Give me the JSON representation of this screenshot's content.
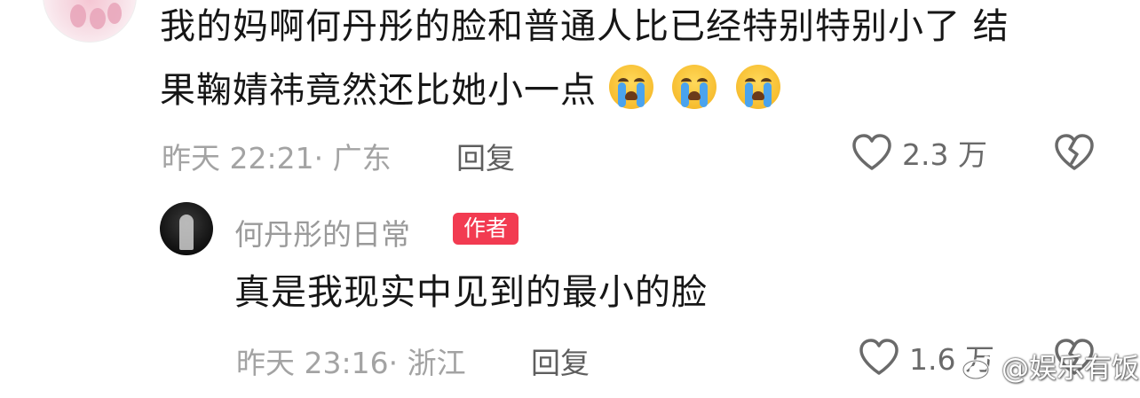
{
  "comment": {
    "text_line1": "我的妈啊何丹彤的脸和普通人比已经特别特别小了 结",
    "text_line2": "果鞠婧祎竟然还比她小一点",
    "emoji": [
      "crying-face",
      "crying-face",
      "crying-face"
    ],
    "time_location": "昨天 22:21· 广东",
    "reply_label": "回复",
    "like_count": "2.3 万"
  },
  "reply": {
    "username": "何丹彤的日常",
    "badge": "作者",
    "text": "真是我现实中见到的最小的脸",
    "time_location": "昨天 23:16· 浙江",
    "reply_label": "回复",
    "like_count": "1.6 万"
  },
  "watermark": {
    "text": "@娱乐有饭",
    "icon": "weibo-logo"
  },
  "colors": {
    "author_badge": "#f23b51",
    "meta_text": "#a3a3a3",
    "icon_gray": "#6a6a6a"
  }
}
